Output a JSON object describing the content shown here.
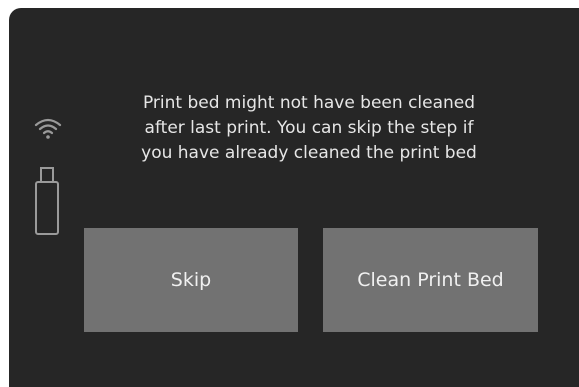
{
  "status": {
    "wifi_icon": "wifi-icon",
    "usb_icon": "usb-drive-icon"
  },
  "dialog": {
    "message": "Print bed might not have been cleaned\nafter last print. You can skip the step if\nyou have already cleaned the print bed"
  },
  "buttons": {
    "skip_label": "Skip",
    "clean_label": "Clean Print Bed"
  },
  "colors": {
    "background": "#262626",
    "button": "#727272",
    "text": "#e6e6e6",
    "icon": "#9a9a9a"
  }
}
